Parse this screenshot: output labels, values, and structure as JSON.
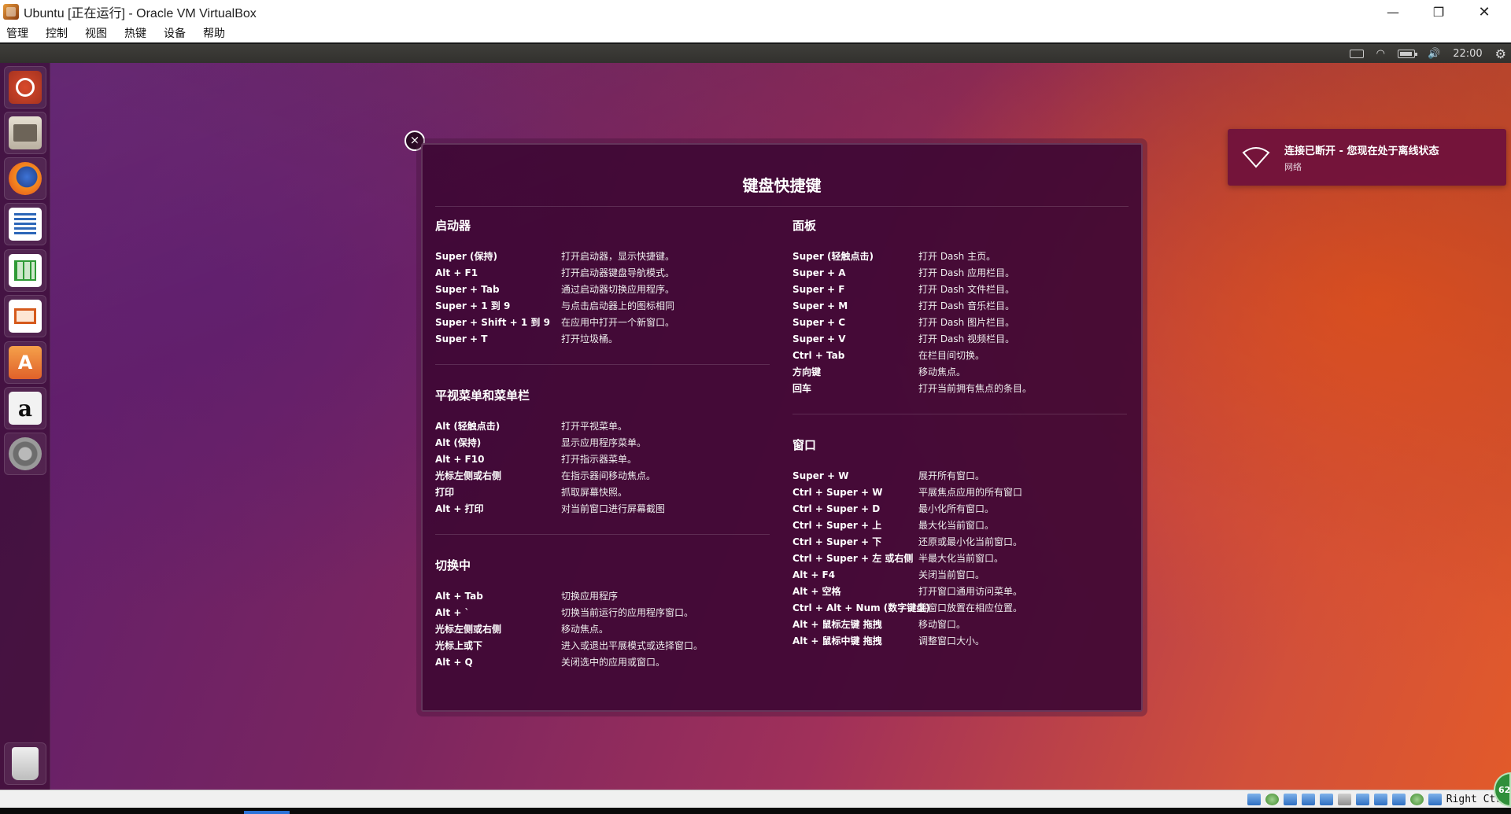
{
  "window": {
    "title": "Ubuntu [正在运行] - Oracle VM VirtualBox",
    "min_glyph": "—",
    "max_glyph": "❐",
    "close_glyph": "✕"
  },
  "menubar": [
    "管理",
    "控制",
    "视图",
    "热键",
    "设备",
    "帮助"
  ],
  "panel": {
    "clock": "22:00",
    "volume_glyph": "🔊",
    "wifi_glyph": "◠",
    "gear_glyph": "⚙"
  },
  "launcher": [
    {
      "name": "dash",
      "icon": "ubuntu-dash-icon"
    },
    {
      "name": "files",
      "icon": "files-icon"
    },
    {
      "name": "firefox",
      "icon": "firefox-icon"
    },
    {
      "name": "writer",
      "icon": "libreoffice-writer-icon"
    },
    {
      "name": "calc",
      "icon": "libreoffice-calc-icon"
    },
    {
      "name": "impress",
      "icon": "libreoffice-impress-icon"
    },
    {
      "name": "software",
      "icon": "ubuntu-software-icon",
      "glyph": "A"
    },
    {
      "name": "amazon",
      "icon": "amazon-icon",
      "glyph": "a"
    },
    {
      "name": "settings",
      "icon": "system-settings-icon"
    },
    {
      "name": "trash",
      "icon": "trash-icon"
    }
  ],
  "overlay": {
    "title": "键盘快捷键",
    "close_glyph": "×",
    "left_sections": [
      {
        "title": "启动器",
        "rows": [
          [
            "Super (保持)",
            "打开启动器，显示快捷键。"
          ],
          [
            "Alt + F1",
            "打开启动器键盘导航模式。"
          ],
          [
            "Super + Tab",
            "通过启动器切换应用程序。"
          ],
          [
            "Super + 1 到 9",
            "与点击启动器上的图标相同"
          ],
          [
            "Super + Shift + 1 到 9",
            "在应用中打开一个新窗口。"
          ],
          [
            "Super + T",
            "打开垃圾桶。"
          ]
        ]
      },
      {
        "title": "平视菜单和菜单栏",
        "rows": [
          [
            "Alt (轻触点击)",
            "打开平视菜单。"
          ],
          [
            "Alt (保持)",
            "显示应用程序菜单。"
          ],
          [
            "Alt + F10",
            "打开指示器菜单。"
          ],
          [
            "光标左侧或右侧",
            "在指示器间移动焦点。"
          ],
          [
            "打印",
            "抓取屏幕快照。"
          ],
          [
            "Alt + 打印",
            "对当前窗口进行屏幕截图"
          ]
        ]
      },
      {
        "title": "切换中",
        "rows": [
          [
            "Alt + Tab",
            "切换应用程序"
          ],
          [
            "Alt + `",
            "切换当前运行的应用程序窗口。"
          ],
          [
            "光标左侧或右侧",
            "移动焦点。"
          ],
          [
            "光标上或下",
            "进入或退出平展模式或选择窗口。"
          ],
          [
            "Alt + Q",
            "关闭选中的应用或窗口。"
          ]
        ]
      }
    ],
    "right_sections": [
      {
        "title": "面板",
        "rows": [
          [
            "Super (轻触点击)",
            "打开 Dash 主页。"
          ],
          [
            "Super + A",
            "打开 Dash 应用栏目。"
          ],
          [
            "Super + F",
            "打开 Dash 文件栏目。"
          ],
          [
            "Super + M",
            "打开 Dash 音乐栏目。"
          ],
          [
            "Super + C",
            "打开 Dash 图片栏目。"
          ],
          [
            "Super + V",
            "打开 Dash 视频栏目。"
          ],
          [
            "Ctrl + Tab",
            "在栏目间切换。"
          ],
          [
            "方向键",
            "移动焦点。"
          ],
          [
            "回车",
            "打开当前拥有焦点的条目。"
          ]
        ]
      },
      {
        "title": "窗口",
        "rows": [
          [
            "Super + W",
            "展开所有窗口。"
          ],
          [
            "Ctrl + Super + W",
            "平展焦点应用的所有窗口"
          ],
          [
            "Ctrl + Super + D",
            "最小化所有窗口。"
          ],
          [
            "Ctrl + Super + 上",
            "最大化当前窗口。"
          ],
          [
            "Ctrl + Super + 下",
            "还原或最小化当前窗口。"
          ],
          [
            "Ctrl + Super + 左 或右侧",
            "半最大化当前窗口。"
          ],
          [
            "Alt + F4",
            "关闭当前窗口。"
          ],
          [
            "Alt + 空格",
            "打开窗口通用访问菜单。"
          ],
          [
            "Ctrl + Alt + Num (数字键盘)",
            "将窗口放置在相应位置。"
          ],
          [
            "Alt + 鼠标左键 拖拽",
            "移动窗口。"
          ],
          [
            "Alt + 鼠标中键 拖拽",
            "调整窗口大小。"
          ]
        ]
      }
    ]
  },
  "notification": {
    "title": "连接已断开 - 您现在处于离线状态",
    "subtitle": "网络"
  },
  "statusbar": {
    "host_key": "Right Ctrl",
    "net_badge": "62"
  },
  "colors": {
    "ubuntu_orange": "#e95420",
    "aubergine": "#3e0834",
    "notification_bg": "#6e103c"
  }
}
